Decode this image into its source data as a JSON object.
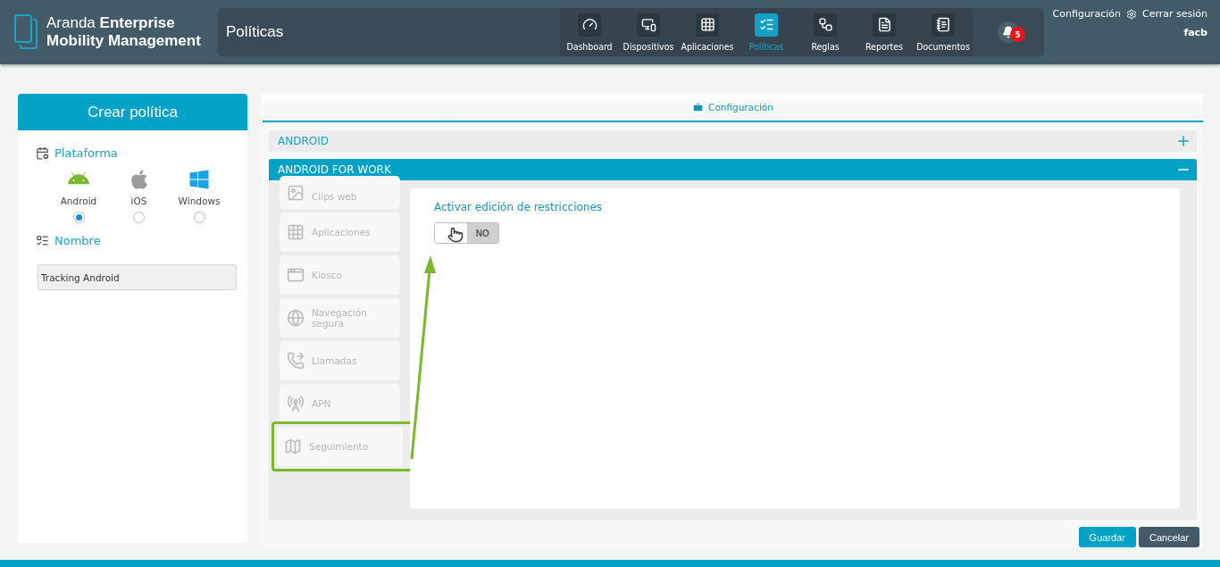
{
  "header": {
    "logo_light": "Aranda",
    "logo_bold": "Enterprise",
    "logo_line2": "Mobility Management",
    "page_title": "Políticas",
    "nav": [
      {
        "label": "Dashboard",
        "kind": "gauge",
        "selected": false
      },
      {
        "label": "Dispositivos",
        "kind": "devices",
        "selected": false
      },
      {
        "label": "Aplicaciones",
        "kind": "grid",
        "selected": false
      },
      {
        "label": "Políticas",
        "kind": "checklist",
        "selected": true
      },
      {
        "label": "Reglas",
        "kind": "rules",
        "selected": false
      },
      {
        "label": "Reportes",
        "kind": "report",
        "selected": false
      },
      {
        "label": "Documentos",
        "kind": "document",
        "selected": false
      }
    ],
    "notifications": "5",
    "config_link": "Configuración",
    "logout_link": "Cerrar sesión",
    "username": "facb"
  },
  "sidebar": {
    "title": "Crear política",
    "platform_label": "Plataforma",
    "platforms": [
      {
        "label": "Android",
        "kind": "android",
        "selected": true
      },
      {
        "label": "iOS",
        "kind": "apple",
        "selected": false
      },
      {
        "label": "Windows",
        "kind": "windows",
        "selected": false
      }
    ],
    "name_label": "Nombre",
    "name_value": "Tracking Android"
  },
  "main": {
    "tab": "Configuración",
    "sections": [
      {
        "title": "ANDROID",
        "expanded": false
      },
      {
        "title": "ANDROID FOR WORK",
        "expanded": true
      }
    ],
    "menu": [
      {
        "label": "Clips web",
        "kind": "image",
        "highlighted": false
      },
      {
        "label": "Aplicaciones",
        "kind": "grid",
        "highlighted": false
      },
      {
        "label": "Kiosco",
        "kind": "kiosk",
        "highlighted": false
      },
      {
        "label": "Navegación segura",
        "kind": "globe",
        "highlighted": false
      },
      {
        "label": "Llamadas",
        "kind": "phone",
        "highlighted": false
      },
      {
        "label": "APN",
        "kind": "apn",
        "highlighted": false
      },
      {
        "label": "Seguimiento",
        "kind": "map",
        "highlighted": true
      }
    ],
    "toggle": {
      "label": "Activar edición de restricciones",
      "state": "NO",
      "on": false
    },
    "buttons": [
      {
        "label": "Guardar",
        "kind": "primary"
      },
      {
        "label": "Cancelar",
        "kind": "secondary"
      }
    ]
  }
}
